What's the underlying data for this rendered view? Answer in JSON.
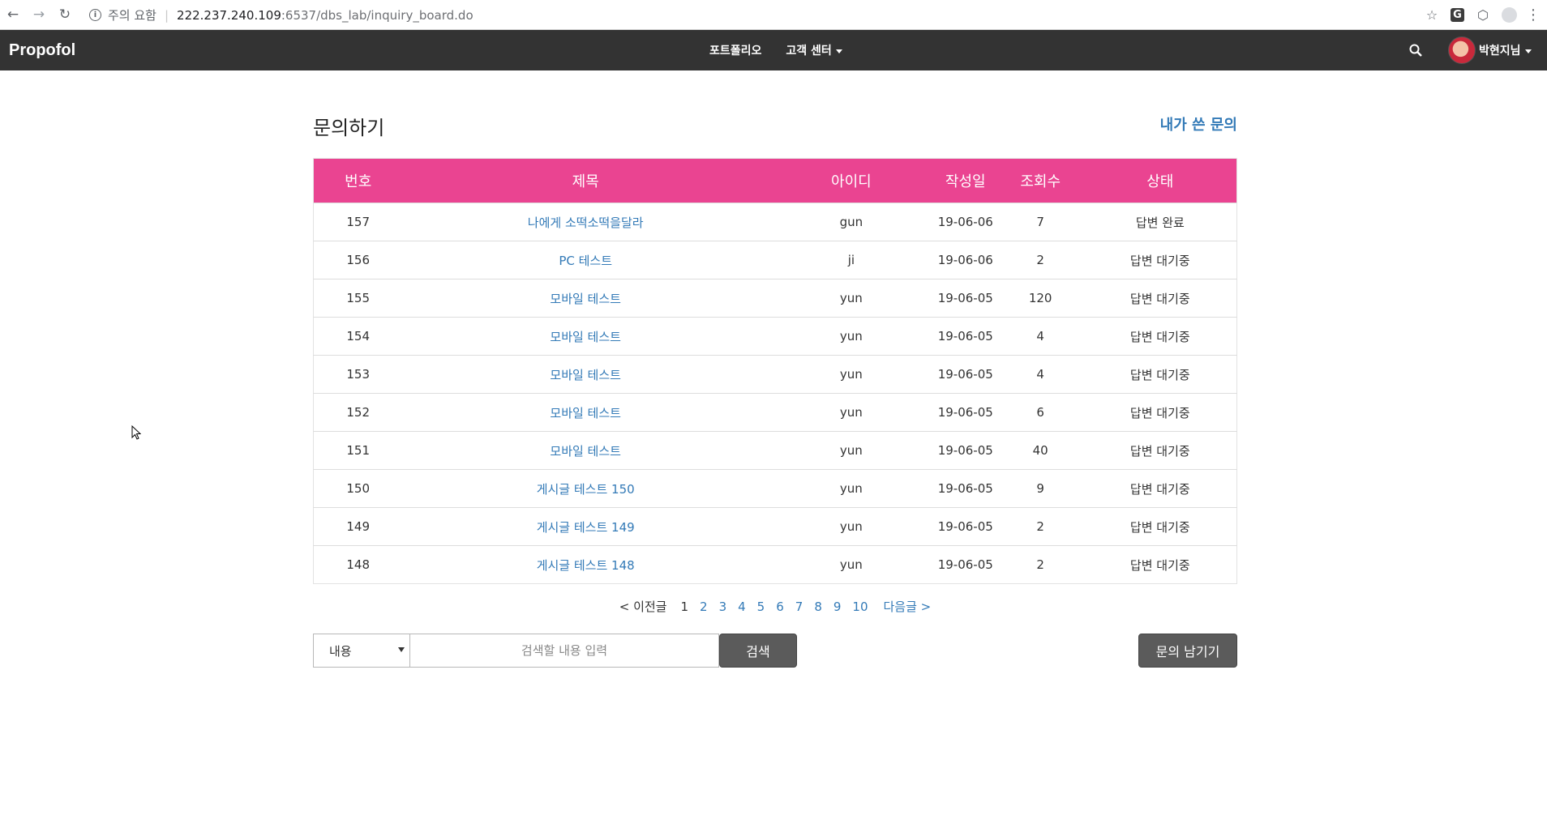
{
  "browser": {
    "warning": "주의 요함",
    "url_host": "222.237.240.109",
    "url_port_path": ":6537/dbs_lab/inquiry_board.do",
    "ext_label": "G"
  },
  "site": {
    "brand": "Propofol",
    "nav": [
      {
        "label": "포트폴리오"
      },
      {
        "label": "고객 센터"
      }
    ],
    "user_name": "박현지님"
  },
  "page": {
    "title": "문의하기",
    "my_inquiries_link": "내가 쓴 문의"
  },
  "table": {
    "headers": [
      "번호",
      "제목",
      "아이디",
      "작성일",
      "조회수",
      "상태"
    ],
    "rows": [
      {
        "no": "157",
        "title": "나에게 소떡소떡을달라",
        "id": "gun",
        "date": "19-06-06",
        "views": "7",
        "status": "답변 완료"
      },
      {
        "no": "156",
        "title": "PC 테스트",
        "id": "ji",
        "date": "19-06-06",
        "views": "2",
        "status": "답변 대기중"
      },
      {
        "no": "155",
        "title": "모바일 테스트",
        "id": "yun",
        "date": "19-06-05",
        "views": "120",
        "status": "답변 대기중"
      },
      {
        "no": "154",
        "title": "모바일 테스트",
        "id": "yun",
        "date": "19-06-05",
        "views": "4",
        "status": "답변 대기중"
      },
      {
        "no": "153",
        "title": "모바일 테스트",
        "id": "yun",
        "date": "19-06-05",
        "views": "4",
        "status": "답변 대기중"
      },
      {
        "no": "152",
        "title": "모바일 테스트",
        "id": "yun",
        "date": "19-06-05",
        "views": "6",
        "status": "답변 대기중"
      },
      {
        "no": "151",
        "title": "모바일 테스트",
        "id": "yun",
        "date": "19-06-05",
        "views": "40",
        "status": "답변 대기중"
      },
      {
        "no": "150",
        "title": "게시글 테스트 150",
        "id": "yun",
        "date": "19-06-05",
        "views": "9",
        "status": "답변 대기중"
      },
      {
        "no": "149",
        "title": "게시글 테스트 149",
        "id": "yun",
        "date": "19-06-05",
        "views": "2",
        "status": "답변 대기중"
      },
      {
        "no": "148",
        "title": "게시글 테스트 148",
        "id": "yun",
        "date": "19-06-05",
        "views": "2",
        "status": "답변 대기중"
      }
    ]
  },
  "pagination": {
    "prev": "< 이전글",
    "pages": [
      "1",
      "2",
      "3",
      "4",
      "5",
      "6",
      "7",
      "8",
      "9",
      "10"
    ],
    "current": "1",
    "next": "다음글 >"
  },
  "search": {
    "select_value": "내용",
    "placeholder": "검색할 내용 입력",
    "button": "검색"
  },
  "write_button": "문의 남기기",
  "colors": {
    "header_pink": "#ea4491",
    "navbar": "#333333",
    "link_blue": "#337ab7",
    "button_dark": "#5b5b5b"
  },
  "icons": {
    "back": "arrow-left-icon",
    "forward": "arrow-right-icon",
    "reload": "reload-icon",
    "info": "info-icon",
    "star": "star-icon",
    "search": "search-icon"
  }
}
